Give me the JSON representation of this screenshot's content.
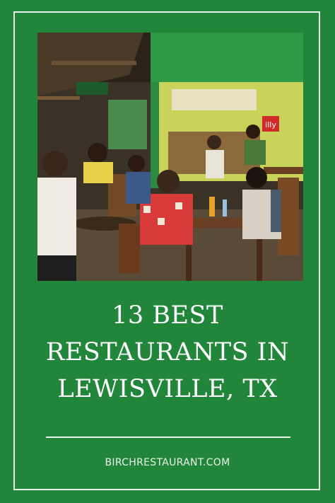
{
  "title_lines": [
    "13 BEST",
    "RESTAURANTS IN",
    "LEWISVILLE, TX"
  ],
  "site": "BIRCHRESTAURANT.COM",
  "photo": {
    "sign_text": "illy"
  },
  "colors": {
    "background": "#22863a",
    "frame": "#e9f2ea",
    "text": "#ffffff"
  }
}
